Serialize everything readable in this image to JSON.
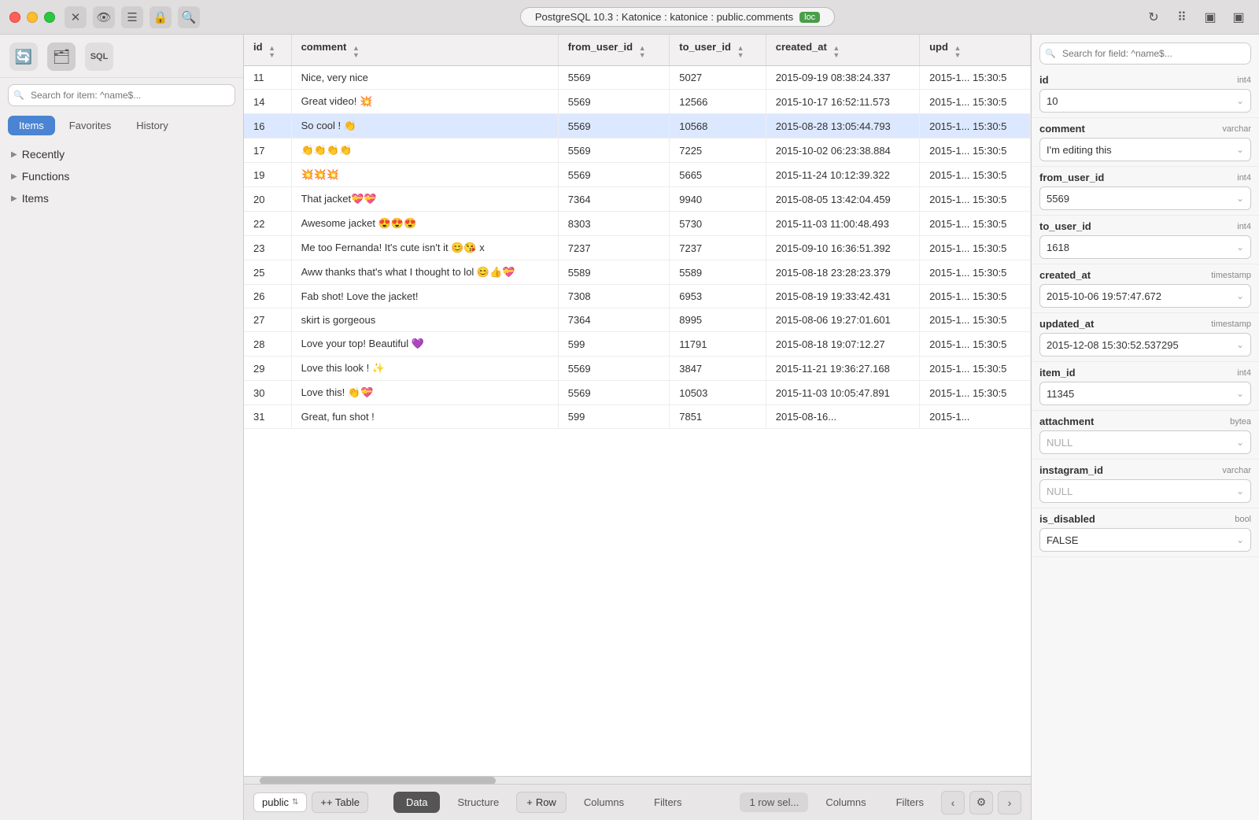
{
  "titlebar": {
    "db_label": "PostgreSQL 10.3 : Katonice : katonice : public.comments",
    "loc_badge": "loc"
  },
  "sidebar": {
    "search_placeholder": "Search for item: ^name$...",
    "tabs": [
      "Items",
      "Favorites",
      "History"
    ],
    "active_tab": "Items",
    "tree": [
      {
        "label": "Recently",
        "expanded": false
      },
      {
        "label": "Functions",
        "expanded": false
      },
      {
        "label": "Items",
        "expanded": false
      }
    ]
  },
  "table": {
    "columns": [
      "id",
      "comment",
      "from_user_id",
      "to_user_id",
      "created_at",
      "upd"
    ],
    "rows": [
      {
        "id": "11",
        "comment": "Nice, very nice",
        "from_user_id": "5569",
        "to_user_id": "5027",
        "created_at": "2015-09-19 08:38:24.337",
        "upd": "2015-1... 15:30:5"
      },
      {
        "id": "14",
        "comment": "Great video! 💥",
        "from_user_id": "5569",
        "to_user_id": "12566",
        "created_at": "2015-10-17 16:52:11.573",
        "upd": "2015-1... 15:30:5"
      },
      {
        "id": "16",
        "comment": "So cool ! 👏",
        "from_user_id": "5569",
        "to_user_id": "10568",
        "created_at": "2015-08-28 13:05:44.793",
        "upd": "2015-1... 15:30:5",
        "selected": true
      },
      {
        "id": "17",
        "comment": "👏👏👏👏",
        "from_user_id": "5569",
        "to_user_id": "7225",
        "created_at": "2015-10-02 06:23:38.884",
        "upd": "2015-1... 15:30:5"
      },
      {
        "id": "19",
        "comment": "💥💥💥",
        "from_user_id": "5569",
        "to_user_id": "5665",
        "created_at": "2015-11-24 10:12:39.322",
        "upd": "2015-1... 15:30:5"
      },
      {
        "id": "20",
        "comment": "That jacket💝💝",
        "from_user_id": "7364",
        "to_user_id": "9940",
        "created_at": "2015-08-05 13:42:04.459",
        "upd": "2015-1... 15:30:5"
      },
      {
        "id": "22",
        "comment": "Awesome jacket 😍😍😍",
        "from_user_id": "8303",
        "to_user_id": "5730",
        "created_at": "2015-11-03 11:00:48.493",
        "upd": "2015-1... 15:30:5"
      },
      {
        "id": "23",
        "comment": "Me too Fernanda! It's cute isn't it 😊😘 x",
        "from_user_id": "7237",
        "to_user_id": "7237",
        "created_at": "2015-09-10 16:36:51.392",
        "upd": "2015-1... 15:30:5"
      },
      {
        "id": "25",
        "comment": "Aww thanks that's what I thought to lol 😊👍💝",
        "from_user_id": "5589",
        "to_user_id": "5589",
        "created_at": "2015-08-18 23:28:23.379",
        "upd": "2015-1... 15:30:5"
      },
      {
        "id": "26",
        "comment": "Fab shot! Love the jacket!",
        "from_user_id": "7308",
        "to_user_id": "6953",
        "created_at": "2015-08-19 19:33:42.431",
        "upd": "2015-1... 15:30:5"
      },
      {
        "id": "27",
        "comment": "skirt is gorgeous",
        "from_user_id": "7364",
        "to_user_id": "8995",
        "created_at": "2015-08-06 19:27:01.601",
        "upd": "2015-1... 15:30:5"
      },
      {
        "id": "28",
        "comment": "Love your top! Beautiful 💜",
        "from_user_id": "599",
        "to_user_id": "11791",
        "created_at": "2015-08-18 19:07:12.27",
        "upd": "2015-1... 15:30:5"
      },
      {
        "id": "29",
        "comment": "Love this look ! ✨",
        "from_user_id": "5569",
        "to_user_id": "3847",
        "created_at": "2015-11-21 19:36:27.168",
        "upd": "2015-1... 15:30:5"
      },
      {
        "id": "30",
        "comment": "Love this! 👏💝",
        "from_user_id": "5569",
        "to_user_id": "10503",
        "created_at": "2015-11-03 10:05:47.891",
        "upd": "2015-1... 15:30:5"
      },
      {
        "id": "31",
        "comment": "Great, fun shot !",
        "from_user_id": "599",
        "to_user_id": "7851",
        "created_at": "2015-08-16...",
        "upd": "2015-1..."
      }
    ]
  },
  "right_panel": {
    "search_placeholder": "Search for field: ^name$...",
    "fields": [
      {
        "name": "id",
        "type": "int4",
        "value": "10",
        "is_null": false
      },
      {
        "name": "comment",
        "type": "varchar",
        "value": "I'm editing this",
        "is_null": false
      },
      {
        "name": "from_user_id",
        "type": "int4",
        "value": "5569",
        "is_null": false
      },
      {
        "name": "to_user_id",
        "type": "int4",
        "value": "1618",
        "is_null": false
      },
      {
        "name": "created_at",
        "type": "timestamp",
        "value": "2015-10-06 19:57:47.672",
        "is_null": false
      },
      {
        "name": "updated_at",
        "type": "timestamp",
        "value": "2015-12-08 15:30:52.537295",
        "is_null": false
      },
      {
        "name": "item_id",
        "type": "int4",
        "value": "11345",
        "is_null": false
      },
      {
        "name": "attachment",
        "type": "bytea",
        "value": "NULL",
        "is_null": true
      },
      {
        "name": "instagram_id",
        "type": "varchar",
        "value": "NULL",
        "is_null": true
      },
      {
        "name": "is_disabled",
        "type": "bool",
        "value": "FALSE",
        "is_null": false
      }
    ]
  },
  "bottom_bar": {
    "schema_label": "public",
    "add_table_label": "+ Table",
    "tabs": [
      "Data",
      "Structure",
      "Row",
      "Columns",
      "Filters"
    ],
    "active_tab": "Data",
    "row_sel_label": "1 row sel...",
    "settings_icon": "⚙"
  }
}
